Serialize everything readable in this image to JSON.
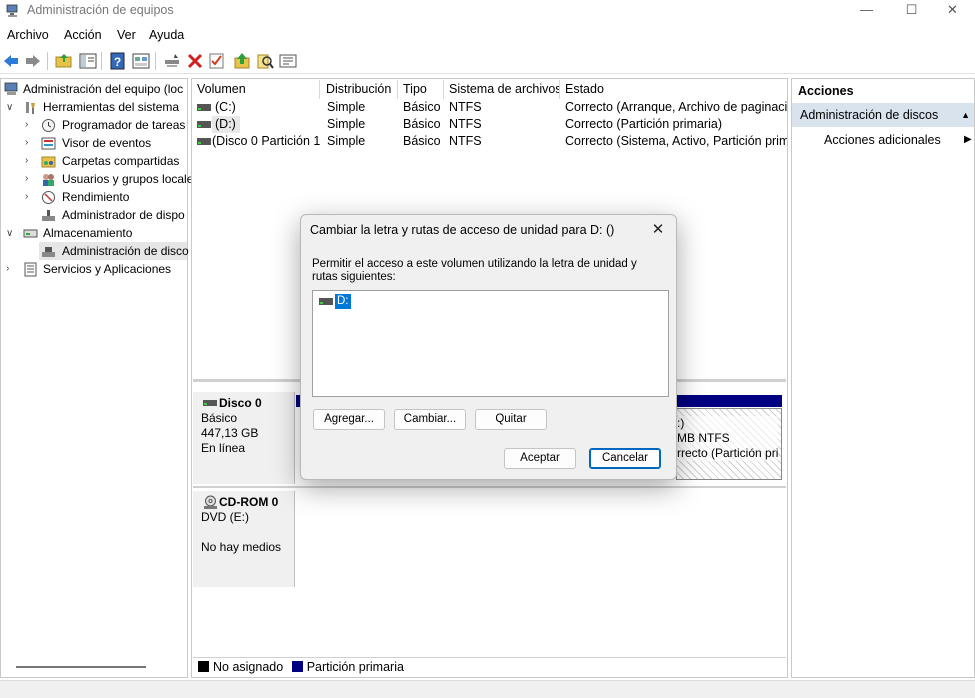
{
  "window": {
    "title": "Administración de equipos",
    "controls": {
      "minimize": "—",
      "maximize": "☐",
      "close": "✕"
    }
  },
  "menu": [
    "Archivo",
    "Acción",
    "Ver",
    "Ayuda"
  ],
  "toolbar": [
    "back-icon",
    "forward-icon",
    "folder-up-icon",
    "show-hide-tree-icon",
    "help-icon",
    "properties-view-icon",
    "connect-icon",
    "delete-icon",
    "check-icon",
    "export-up-icon",
    "search-icon",
    "list-icon"
  ],
  "tree": {
    "root": "Administración del equipo (loc",
    "items": [
      {
        "label": "Herramientas del sistema",
        "level": 1,
        "chevron": "∨"
      },
      {
        "label": "Programador de tareas",
        "level": 2,
        "chevron": "›"
      },
      {
        "label": "Visor de eventos",
        "level": 2,
        "chevron": "›"
      },
      {
        "label": "Carpetas compartidas",
        "level": 2,
        "chevron": "›"
      },
      {
        "label": "Usuarios y grupos locale",
        "level": 2,
        "chevron": "›"
      },
      {
        "label": "Rendimiento",
        "level": 2,
        "chevron": "›"
      },
      {
        "label": "Administrador de dispo",
        "level": 2,
        "chevron": ""
      },
      {
        "label": "Almacenamiento",
        "level": 1,
        "chevron": "∨"
      },
      {
        "label": "Administración de disco",
        "level": 2,
        "chevron": ""
      },
      {
        "label": "Servicios y Aplicaciones",
        "level": 1,
        "chevron": "›"
      }
    ]
  },
  "volumes": {
    "columns": [
      "Volumen",
      "Distribución",
      "Tipo",
      "Sistema de archivos",
      "Estado"
    ],
    "rows": [
      [
        "(C:)",
        "Simple",
        "Básico",
        "NTFS",
        "Correcto (Arranque, Archivo de paginació"
      ],
      [
        "(D:)",
        "Simple",
        "Básico",
        "NTFS",
        "Correcto (Partición primaria)"
      ],
      [
        "(Disco 0 Partición 1)",
        "Simple",
        "Básico",
        "NTFS",
        "Correcto (Sistema, Activo, Partición prima"
      ]
    ]
  },
  "disks": [
    {
      "name": "Disco 0",
      "type": "Básico",
      "size": "447,13 GB",
      "status": "En línea",
      "partition_fragments": [
        ":)",
        "MB NTFS",
        "rrecto (Partición pri"
      ]
    },
    {
      "name": "CD-ROM 0",
      "type": "DVD (E:)",
      "size": "",
      "status": "No hay medios"
    }
  ],
  "legend": [
    {
      "label": "No asignado",
      "color": "#000000"
    },
    {
      "label": "Partición primaria",
      "color": "#000080"
    }
  ],
  "actions": {
    "title": "Acciones",
    "selected": "Administración de discos",
    "more": "Acciones adicionales"
  },
  "dialog": {
    "title": "Cambiar la letra y rutas de acceso de unidad para D: ()",
    "description": "Permitir el acceso a este volumen utilizando la letra de unidad y rutas siguientes:",
    "list_item": "D:",
    "buttons": {
      "add": "Agregar...",
      "change": "Cambiar...",
      "remove": "Quitar",
      "ok": "Aceptar",
      "cancel": "Cancelar"
    }
  },
  "colors": {
    "accent": "#0078d7",
    "primary_partition": "#000080",
    "actions_selected_bg": "#d9e3ee"
  }
}
